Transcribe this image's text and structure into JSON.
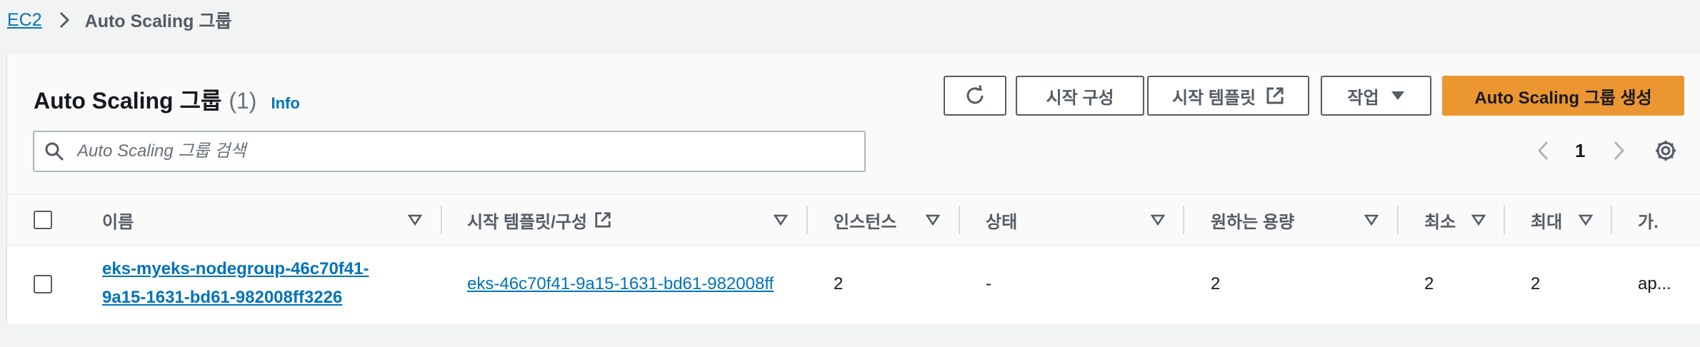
{
  "breadcrumb": {
    "root": "EC2",
    "current": "Auto Scaling 그룹"
  },
  "header": {
    "title": "Auto Scaling 그룹",
    "count": "(1)",
    "info": "Info"
  },
  "toolbar": {
    "refresh_icon": "refresh-icon",
    "config_label": "시작 구성",
    "template_label": "시작 템플릿",
    "actions_label": "작업",
    "create_label": "Auto Scaling 그룹 생성"
  },
  "search": {
    "placeholder": "Auto Scaling 그룹 검색"
  },
  "pagination": {
    "current_page": "1"
  },
  "table": {
    "columns": [
      "이름",
      "시작 템플릿/구성",
      "인스턴스",
      "상태",
      "원하는 용량",
      "최소",
      "최대",
      "가."
    ],
    "rows": [
      {
        "name_line1": "eks-myeks-nodegroup-46c70f41-",
        "name_line2": "9a15-1631-bd61-982008ff3226",
        "template": "eks-46c70f41-9a15-1631-bd61-982008ff",
        "instances": "2",
        "status": "-",
        "desired": "2",
        "min": "2",
        "max": "2",
        "az": "ap..."
      }
    ]
  },
  "colors": {
    "accent": "#0073bb",
    "primary_button": "#ec9632",
    "border": "#545b64"
  }
}
